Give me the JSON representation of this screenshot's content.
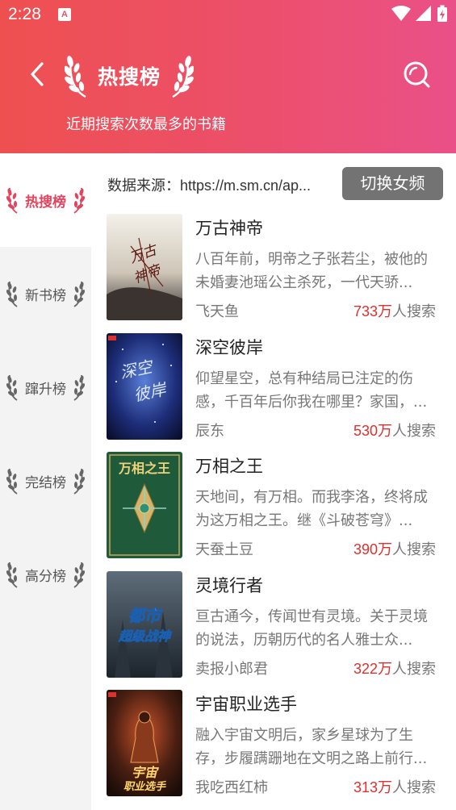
{
  "status": {
    "time": "2:28",
    "notif_letter": "A"
  },
  "header": {
    "title": "热搜榜",
    "subtitle": "近期搜索次数最多的书籍"
  },
  "sidebar": {
    "items": [
      {
        "label": "热搜榜",
        "active": true
      },
      {
        "label": "新书榜",
        "active": false
      },
      {
        "label": "蹿升榜",
        "active": false
      },
      {
        "label": "完结榜",
        "active": false
      },
      {
        "label": "高分榜",
        "active": false
      }
    ]
  },
  "source": {
    "text": "数据来源：https://m.sm.cn/ap...",
    "switch_label": "切换女频"
  },
  "books": [
    {
      "title": "万古神帝",
      "desc": "八百年前，明帝之子张若尘，被他的未婚妻池瑶公主杀死，一代天骄...",
      "author": "飞天鱼",
      "count": "733万",
      "count_suffix": "人搜索",
      "cover_text": "万古神帝"
    },
    {
      "title": "深空彼岸",
      "desc": "仰望星空，总有种结局已注定的伤感，千百年后你我在哪里？家国，...",
      "author": "辰东",
      "count": "530万",
      "count_suffix": "人搜索",
      "cover_text": "深空彼岸"
    },
    {
      "title": "万相之王",
      "desc": "天地间，有万相。而我李洛，终将成为这万相之王。继《斗破苍穹》...",
      "author": "天蚕土豆",
      "count": "390万",
      "count_suffix": "人搜索",
      "cover_text": "万相之王"
    },
    {
      "title": "灵境行者",
      "desc": "亘古通今，传闻世有灵境。关于灵境的说法，历朝历代的名人雅士众...",
      "author": "卖报小郎君",
      "count": "322万",
      "count_suffix": "人搜索",
      "cover_text": "都市超级战神"
    },
    {
      "title": "宇宙职业选手",
      "desc": "融入宇宙文明后，家乡星球为了生存，步履蹒跚地在文明之路上前行...",
      "author": "我吃西红柿",
      "count": "313万",
      "count_suffix": "人搜索",
      "cover_text": "宇宙职业选手"
    }
  ],
  "colors": {
    "header_start": "#ee5050",
    "header_end": "#ea5088",
    "accent_red": "#e0302e",
    "active_pink": "#e2445e",
    "switch_btn": "#737373"
  }
}
